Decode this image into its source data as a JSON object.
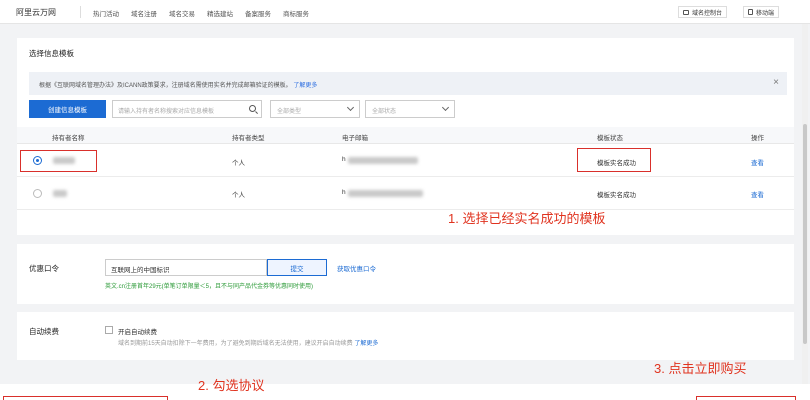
{
  "topbar": {
    "brand": "阿里云万网",
    "nav": [
      "热门活动",
      "域名注册",
      "域名交易",
      "精选建站",
      "备案服务",
      "商标服务"
    ],
    "btn_console": "域名控制台",
    "btn_mobile": "移动端"
  },
  "template_panel": {
    "title": "选择信息模板",
    "notice_text": "根据《互联网域名管理办法》及ICANN政策要求，注册域名需使用实名并完成邮箱验证的模板。",
    "notice_link": "了解更多",
    "close_glyph": "×",
    "create_btn": "创建信息模板",
    "search_placeholder": "请输入持有者名称搜索对应信息模板",
    "type_select": "全部类型",
    "status_select": "全部状态",
    "columns": [
      "持有者名称",
      "持有者类型",
      "电子邮箱",
      "模板状态",
      "操作"
    ],
    "rows": [
      {
        "type": "个人",
        "email_prefix": "h",
        "status": "模板实名成功",
        "action": "查看",
        "selected": true
      },
      {
        "type": "个人",
        "email_prefix": "h",
        "status": "模板实名成功",
        "action": "查看",
        "selected": false
      }
    ]
  },
  "coupon_panel": {
    "title": "优惠口令",
    "input_value": "互联网上的中国标识",
    "submit_btn": "提交",
    "get_link": "获取优惠口令",
    "note": "英文.cn注册首年29元(单笔订单限量＜5，且不与同产品代金券等优惠同时使用)"
  },
  "renew_panel": {
    "title": "自动续费",
    "checkbox_label": "开启自动续费",
    "note": "域名到期前15天自动扣除下一年费用，为了避免到期后域名无法使用，建议开启自动续费",
    "note_link": "了解更多"
  },
  "annotations": {
    "step1": "1. 选择已经实名成功的模板",
    "step2": "2. 勾选协议",
    "step3": "3. 点击立即购买"
  },
  "colors": {
    "primary": "#1c6bd3",
    "annotation": "#e0331f",
    "note_green": "#2b9a37"
  }
}
